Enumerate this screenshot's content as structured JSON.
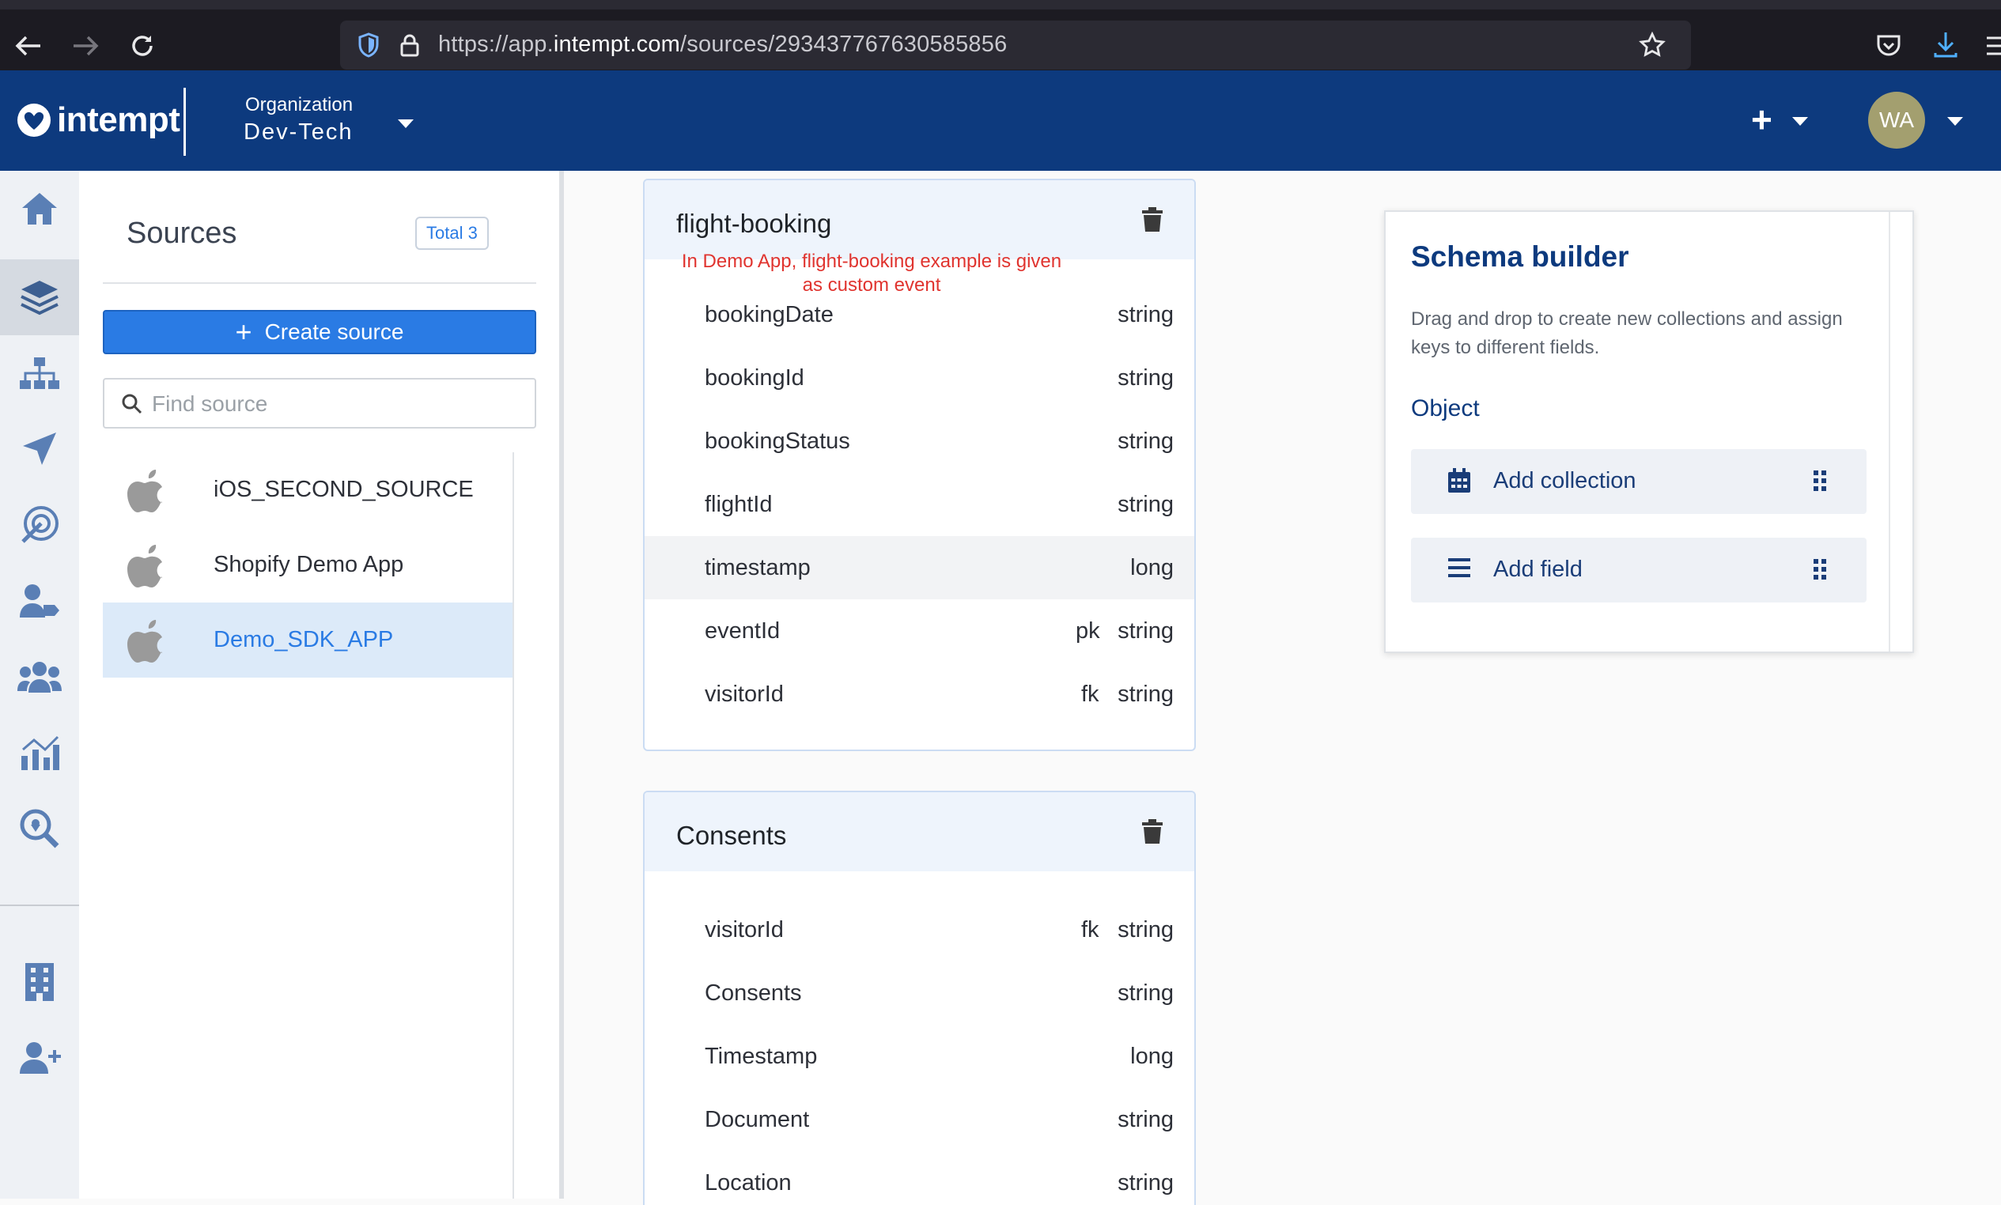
{
  "browser": {
    "url_prefix": "https://app.",
    "url_domain": "intempt.com",
    "url_path": "/sources/293437767630585856"
  },
  "header": {
    "logo_text": "intempt",
    "org_label": "Organization",
    "org_value": "Dev-Tech",
    "avatar_initials": "WA",
    "brand_color": "#0d3a7e"
  },
  "sources": {
    "title": "Sources",
    "total_label": "Total 3",
    "create_label": "Create source",
    "search_placeholder": "Find source",
    "items": [
      {
        "name": "iOS_SECOND_SOURCE",
        "selected": false
      },
      {
        "name": "Shopify Demo App",
        "selected": false
      },
      {
        "name": "Demo_SDK_APP",
        "selected": true
      }
    ]
  },
  "annotation": {
    "line1": "In Demo App, flight-booking example is given",
    "line2": "as custom event"
  },
  "collections": [
    {
      "title": "flight-booking",
      "fields": [
        {
          "name": "bookingDate",
          "key": "",
          "type": "string"
        },
        {
          "name": "bookingId",
          "key": "",
          "type": "string"
        },
        {
          "name": "bookingStatus",
          "key": "",
          "type": "string"
        },
        {
          "name": "flightId",
          "key": "",
          "type": "string"
        },
        {
          "name": "timestamp",
          "key": "",
          "type": "long"
        },
        {
          "name": "eventId",
          "key": "pk",
          "type": "string"
        },
        {
          "name": "visitorId",
          "key": "fk",
          "type": "string"
        }
      ]
    },
    {
      "title": "Consents",
      "fields": [
        {
          "name": "visitorId",
          "key": "fk",
          "type": "string"
        },
        {
          "name": "Consents",
          "key": "",
          "type": "string"
        },
        {
          "name": "Timestamp",
          "key": "",
          "type": "long"
        },
        {
          "name": "Document",
          "key": "",
          "type": "string"
        },
        {
          "name": "Location",
          "key": "",
          "type": "string"
        }
      ]
    }
  ],
  "schema_builder": {
    "title": "Schema builder",
    "description": "Drag and drop to create new collections and assign keys to different fields.",
    "subtitle": "Object",
    "add_collection_label": "Add collection",
    "add_field_label": "Add field"
  }
}
